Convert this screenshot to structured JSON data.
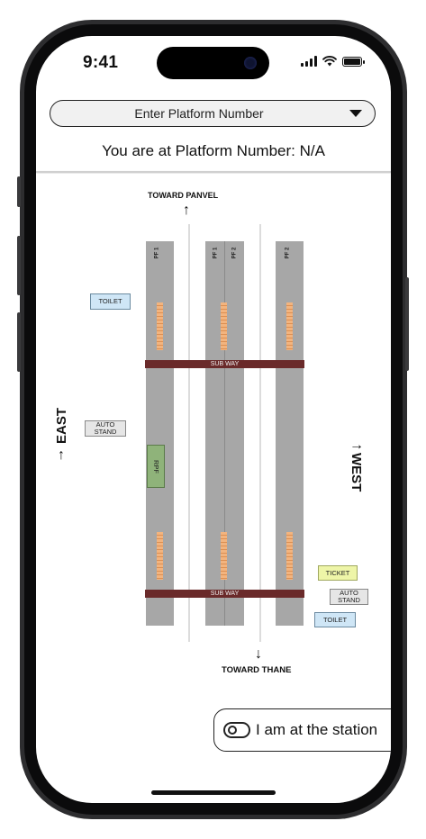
{
  "status_bar": {
    "time": "9:41",
    "icons": [
      "signal-icon",
      "wifi-icon",
      "battery-icon"
    ]
  },
  "platform_select": {
    "placeholder": "Enter Platform Number",
    "icon": "chevron-down-icon"
  },
  "location_status": "You are at Platform Number: N/A",
  "map": {
    "north_label": "TOWARD PANVEL",
    "south_label": "TOWARD THANE",
    "east_label": "EAST",
    "west_label": "WEST",
    "up_arrow": "↑",
    "down_arrow": "↓",
    "west_arrow": "→",
    "east_arrow": "↑",
    "platforms": [
      "PF 1",
      "PF 1",
      "PF 2",
      "PF 2"
    ],
    "subway_label": "SUB WAY",
    "facilities": {
      "toilet": "TOILET",
      "auto_stand": "AUTO STAND",
      "rpf": "RPF",
      "ticket": "TICKET"
    },
    "colors": {
      "platform": "#a7a7a7",
      "subway": "#6a2a2a",
      "stairs": "#f2b47f",
      "toilet": "#cfe6f6",
      "ticket": "#eef5a8",
      "rpf": "#8fb37a"
    }
  },
  "station_toggle": {
    "label": "I am at the station",
    "icon": "toggle-icon",
    "checked": false
  }
}
